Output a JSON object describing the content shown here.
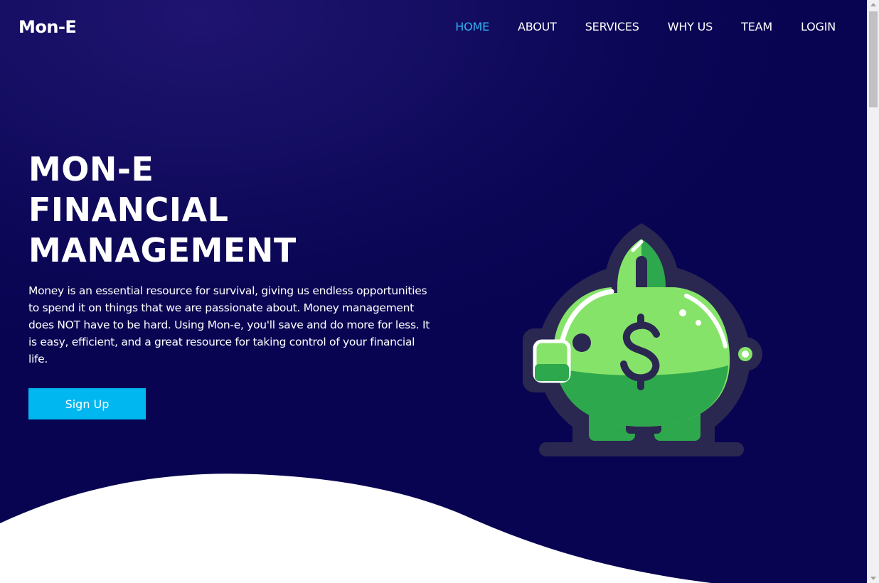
{
  "brand": {
    "name": "Mon-E"
  },
  "nav": {
    "items": [
      {
        "label": "HOME",
        "active": true
      },
      {
        "label": "ABOUT",
        "active": false
      },
      {
        "label": "SERVICES",
        "active": false
      },
      {
        "label": "WHY US",
        "active": false
      },
      {
        "label": "TEAM",
        "active": false
      },
      {
        "label": "LOGIN",
        "active": false
      }
    ]
  },
  "hero": {
    "title_lines": [
      "MON-E",
      "FINANCIAL",
      "MANAGEMENT"
    ],
    "description": "Money is an essential resource for survival, giving us endless opportunities to spend it on things that we are passionate about. Money management does NOT have to be hard. Using Mon-e, you'll save and do more for less. It is easy, efficient, and a great resource for taking control of your financial life.",
    "cta_label": "Sign Up",
    "illustration": "piggy-bank-sprout-icon"
  },
  "colors": {
    "background": "#0b0655",
    "accent": "#00b7f0",
    "nav_active": "#2fb6f2",
    "text": "#ffffff",
    "piggy_green": "#86e36a",
    "piggy_dark_green": "#2ea84c",
    "outline": "#2a2750"
  }
}
